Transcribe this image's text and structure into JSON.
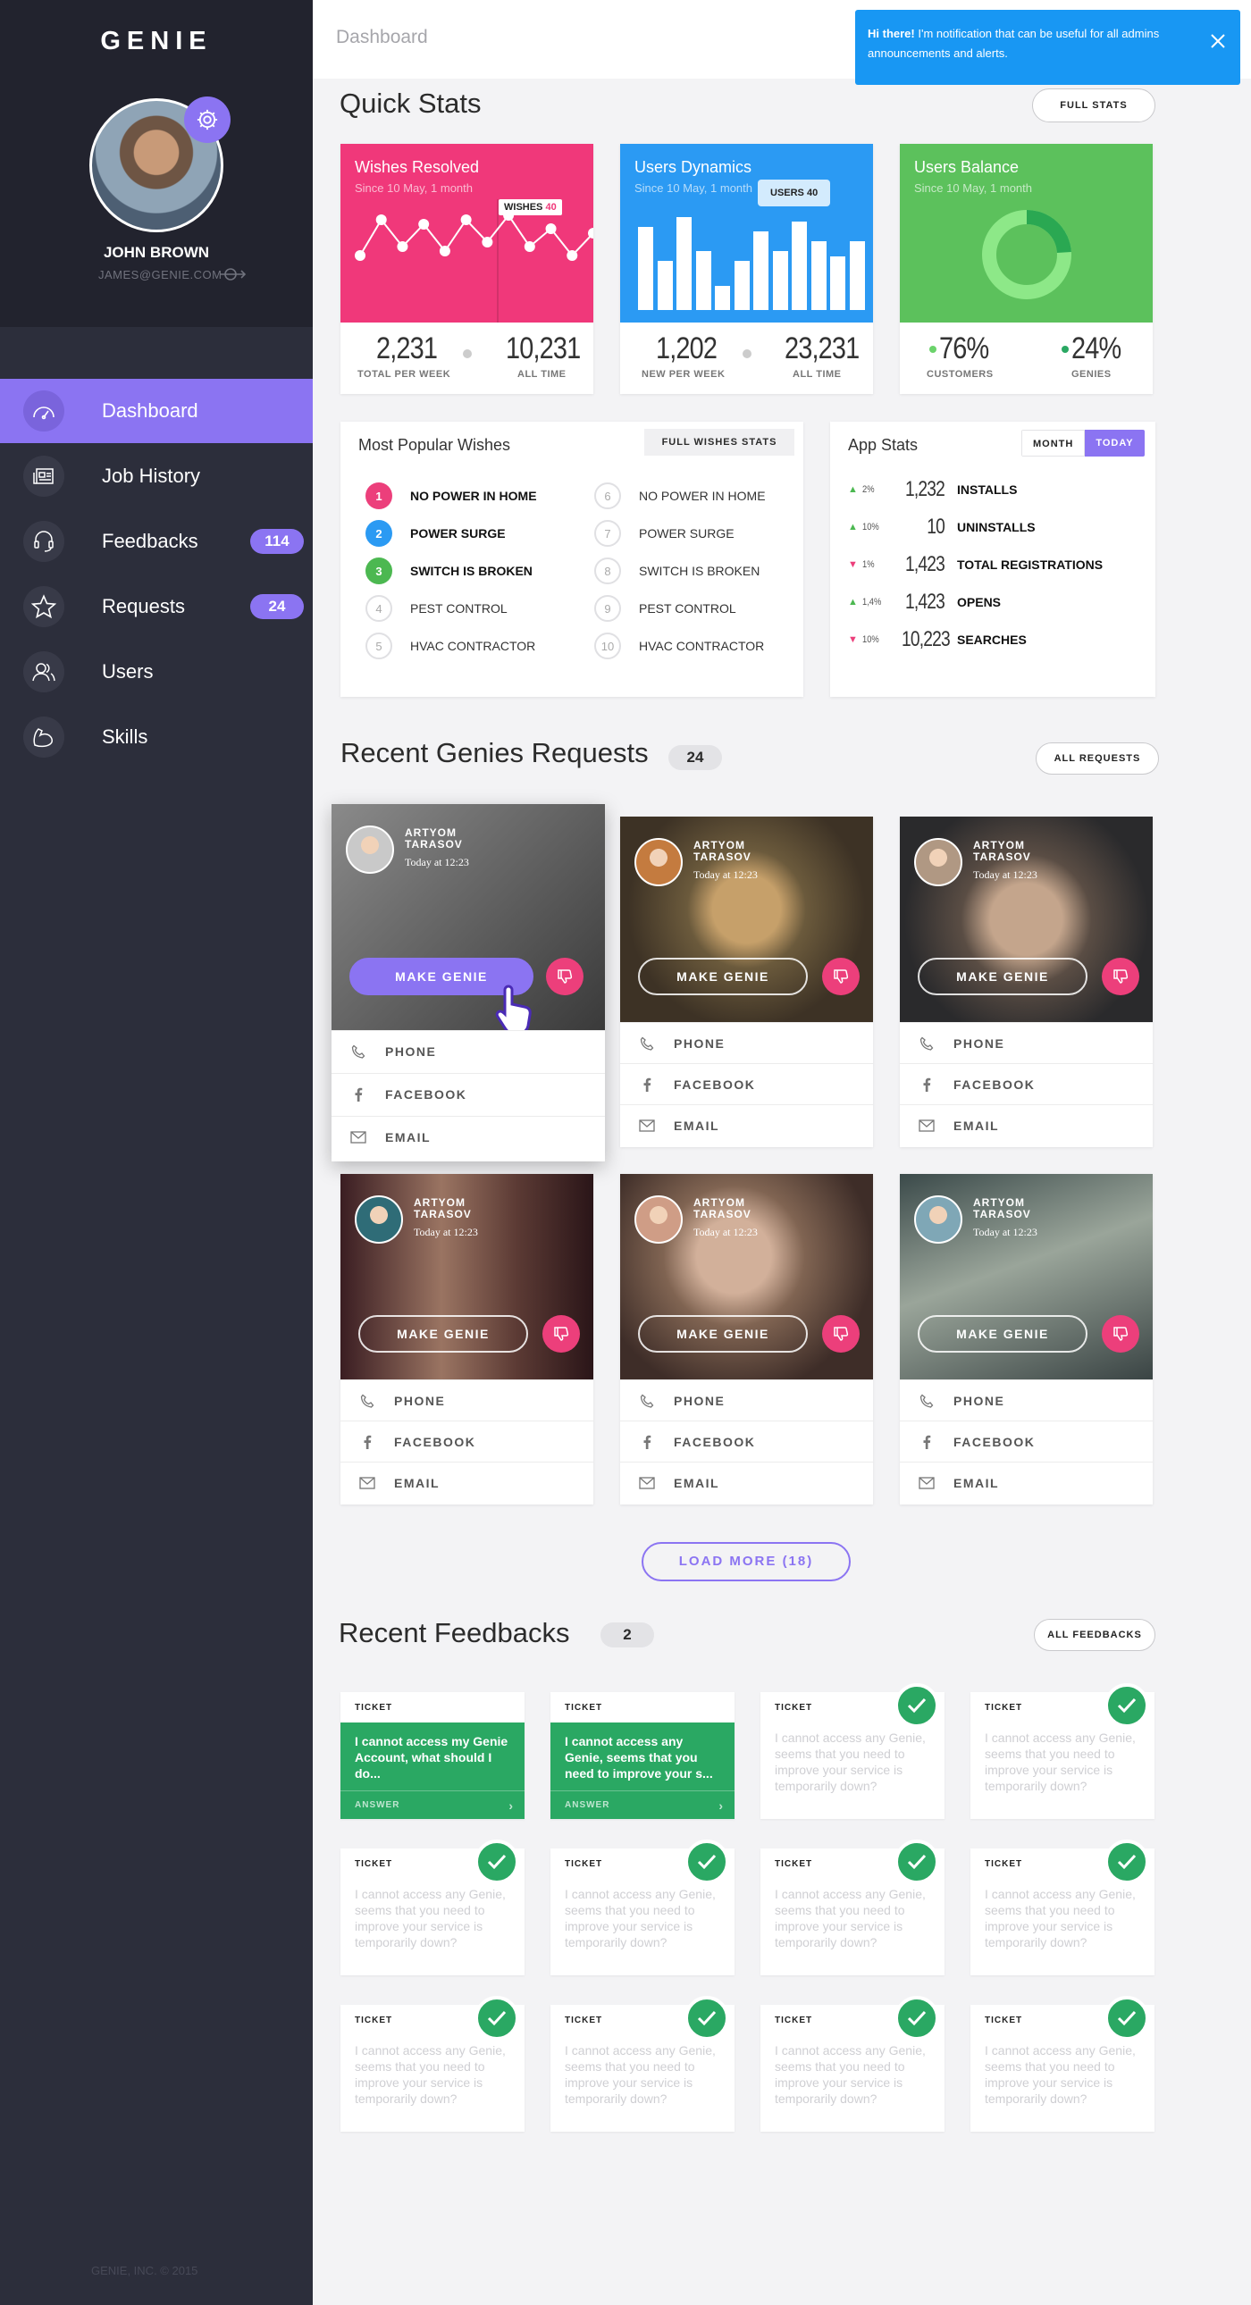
{
  "sidebar": {
    "brand": "GENIE",
    "user": {
      "name": "JOHN BROWN",
      "email": "JAMES@GENIE.COM"
    },
    "nav": [
      {
        "label": "Dashboard",
        "icon": "gauge-icon",
        "active": true
      },
      {
        "label": "Job History",
        "icon": "newspaper-icon"
      },
      {
        "label": "Feedbacks",
        "icon": "headset-icon",
        "badge": "114"
      },
      {
        "label": "Requests",
        "icon": "star-icon",
        "badge": "24"
      },
      {
        "label": "Users",
        "icon": "users-icon"
      },
      {
        "label": "Skills",
        "icon": "muscle-icon"
      }
    ],
    "copyright": "GENIE, INC. © 2015"
  },
  "header": {
    "breadcrumb": "Dashboard"
  },
  "notification": {
    "bold": "Hi there!",
    "text": " I'm notification that can be useful for all admins announcements and alerts."
  },
  "quick_stats": {
    "title": "Quick Stats",
    "button": "FULL STATS",
    "cards": [
      {
        "title": "Wishes Resolved",
        "subtitle": "Since 10 May, 1 month",
        "color": "#f0387a",
        "tooltip_label": "WISHES",
        "tooltip_value": "40",
        "left_value": "2,231",
        "left_caption": "TOTAL PER WEEK",
        "right_value": "10,231",
        "right_caption": "ALL TIME"
      },
      {
        "title": "Users Dynamics",
        "subtitle": "Since 10 May, 1 month",
        "color": "#2b9af3",
        "tooltip_label": "USERS",
        "tooltip_value": "40",
        "left_value": "1,202",
        "left_caption": "NEW PER WEEK",
        "right_value": "23,231",
        "right_caption": "ALL TIME"
      },
      {
        "title": "Users Balance",
        "subtitle": "Since 10 May, 1 month",
        "color": "#5cc15c",
        "left_value": "76%",
        "left_caption": "CUSTOMERS",
        "right_value": "24%",
        "right_caption": "GENIES"
      }
    ],
    "wishes_series": [
      0.45,
      0.85,
      0.55,
      0.8,
      0.5,
      0.85,
      0.6,
      0.9,
      0.55,
      0.75,
      0.45,
      0.7
    ],
    "users_series": [
      0.85,
      0.5,
      0.95,
      0.6,
      0.25,
      0.5,
      0.8,
      0.6,
      0.9,
      0.7,
      0.55,
      0.7
    ],
    "balance_series": [
      0.76,
      0.24
    ]
  },
  "popular": {
    "title": "Most Popular Wishes",
    "button": "FULL WISHES STATS",
    "left": [
      {
        "n": "1",
        "label": "NO POWER IN HOME",
        "color": "#ec3f7b"
      },
      {
        "n": "2",
        "label": "POWER SURGE",
        "color": "#2b9af3"
      },
      {
        "n": "3",
        "label": "SWITCH IS BROKEN",
        "color": "#4cb851"
      },
      {
        "n": "4",
        "label": "PEST CONTROL"
      },
      {
        "n": "5",
        "label": "HVAC CONTRACTOR"
      }
    ],
    "right": [
      {
        "n": "6",
        "label": "NO POWER IN HOME"
      },
      {
        "n": "7",
        "label": "POWER SURGE"
      },
      {
        "n": "8",
        "label": "SWITCH IS BROKEN"
      },
      {
        "n": "9",
        "label": "PEST CONTROL"
      },
      {
        "n": "10",
        "label": "HVAC CONTRACTOR"
      }
    ]
  },
  "app_stats": {
    "title": "App Stats",
    "seg_month": "MONTH",
    "seg_today": "TODAY",
    "rows": [
      {
        "dir": "up",
        "pct": "2%",
        "value": "1,232",
        "label": "INSTALLS"
      },
      {
        "dir": "up",
        "pct": "10%",
        "value": "10",
        "label": "UNINSTALLS"
      },
      {
        "dir": "down",
        "pct": "1%",
        "value": "1,423",
        "label": "TOTAL REGISTRATIONS"
      },
      {
        "dir": "up",
        "pct": "1,4%",
        "value": "1,423",
        "label": "OPENS"
      },
      {
        "dir": "down",
        "pct": "10%",
        "value": "10,223",
        "label": "SEARCHES"
      }
    ],
    "up_color": "#4cb851",
    "down_color": "#ec3f7b"
  },
  "requests": {
    "title": "Recent Genies Requests",
    "count": "24",
    "button": "ALL REQUESTS",
    "name": "ARTYOM TARASOV",
    "time": "Today at 12:23",
    "action": "MAKE GENIE",
    "rows": [
      "PHONE",
      "FACEBOOK",
      "EMAIL"
    ],
    "load_more": "LOAD MORE (18)"
  },
  "feedbacks": {
    "title": "Recent Feedbacks",
    "count": "2",
    "button": "ALL FEEDBACKS",
    "ticket_label": "TICKET",
    "open_texts": [
      "I cannot access my Genie Account, what should I do...",
      "I cannot access any Genie, seems that you need to improve your s..."
    ],
    "answer": "ANSWER",
    "closed_text": "I cannot access any Genie, seems that you need to improve your service is temporarily down?"
  },
  "accent": "#8b74f2"
}
